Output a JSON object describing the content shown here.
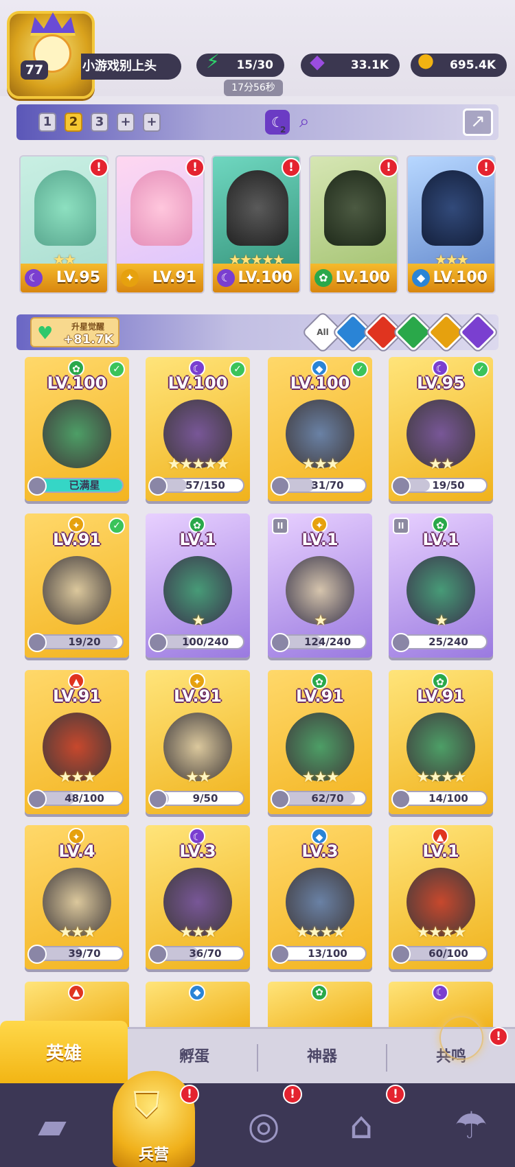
{
  "header": {
    "player_level": "77",
    "player_name": "小游戏别上头",
    "energy": "15/30",
    "energy_timer": "17分56秒",
    "gems": "33.1K",
    "gold": "695.4K"
  },
  "team_bar": {
    "tabs": [
      "1",
      "2",
      "3",
      "+",
      "+"
    ],
    "active_tab": "2",
    "moon_badge_count": "2"
  },
  "team": [
    {
      "level": "LV.95",
      "stars": "★★",
      "element": "moon",
      "alert": "!"
    },
    {
      "level": "LV.91",
      "stars": "",
      "element": "light",
      "alert": "!"
    },
    {
      "level": "LV.100",
      "stars": "★★★★★",
      "element": "moon",
      "alert": "!"
    },
    {
      "level": "LV.100",
      "stars": "",
      "element": "nature",
      "alert": "!"
    },
    {
      "level": "LV.100",
      "stars": "★★★",
      "element": "water",
      "alert": "!"
    }
  ],
  "awaken": {
    "title": "升星觉醒",
    "value": "+81.7K"
  },
  "filters": {
    "all_label": "All",
    "elements": [
      "water",
      "fire",
      "nature",
      "light",
      "moon"
    ]
  },
  "heroes": [
    {
      "level": "LV.100",
      "element": "nature",
      "checked": true,
      "stars": "",
      "progress_text": "已满星",
      "progress": 1.0
    },
    {
      "level": "LV.100",
      "element": "moon",
      "checked": true,
      "stars": "★★★★★",
      "progress_text": "57/150",
      "progress": 0.38
    },
    {
      "level": "LV.100",
      "element": "water",
      "checked": true,
      "stars": "★★★",
      "progress_text": "31/70",
      "progress": 0.44
    },
    {
      "level": "LV.95",
      "element": "moon",
      "checked": true,
      "stars": "★★",
      "progress_text": "19/50",
      "progress": 0.38
    },
    {
      "level": "LV.91",
      "element": "light",
      "checked": true,
      "stars": "",
      "progress_text": "19/20",
      "progress": 0.95
    },
    {
      "level": "LV.1",
      "element": "nature",
      "checked": false,
      "stars": "★",
      "progress_text": "100/240",
      "progress": 0.42
    },
    {
      "level": "LV.1",
      "element": "light",
      "checked": false,
      "rank": "II",
      "stars": "★",
      "progress_text": "124/240",
      "progress": 0.52
    },
    {
      "level": "LV.1",
      "element": "nature",
      "checked": false,
      "rank": "II",
      "stars": "★",
      "progress_text": "25/240",
      "progress": 0.1
    },
    {
      "level": "LV.91",
      "element": "fire",
      "checked": false,
      "stars": "★★★",
      "progress_text": "48/100",
      "progress": 0.48
    },
    {
      "level": "LV.91",
      "element": "light",
      "checked": false,
      "stars": "★★",
      "progress_text": "9/50",
      "progress": 0.18
    },
    {
      "level": "LV.91",
      "element": "nature",
      "checked": false,
      "stars": "★★★",
      "progress_text": "62/70",
      "progress": 0.89
    },
    {
      "level": "LV.91",
      "element": "nature",
      "checked": false,
      "stars": "★★★★",
      "progress_text": "14/100",
      "progress": 0.14
    },
    {
      "level": "LV.4",
      "element": "light",
      "checked": false,
      "stars": "★★★",
      "progress_text": "39/70",
      "progress": 0.56
    },
    {
      "level": "LV.3",
      "element": "moon",
      "checked": false,
      "stars": "★★★",
      "progress_text": "36/70",
      "progress": 0.51
    },
    {
      "level": "LV.3",
      "element": "water",
      "checked": false,
      "stars": "★★★★",
      "progress_text": "13/100",
      "progress": 0.13
    },
    {
      "level": "LV.1",
      "element": "fire",
      "checked": false,
      "stars": "★★★★",
      "progress_text": "60/100",
      "progress": 0.6
    }
  ],
  "peek_row": [
    "fire",
    "water",
    "nature",
    "moon"
  ],
  "sub_tabs": [
    "英雄",
    "孵蛋",
    "神器",
    "共鸣"
  ],
  "active_sub_tab": "英雄",
  "nav": {
    "items": [
      "cards-icon",
      "barracks-icon",
      "map-icon",
      "temple-icon",
      "mushroom-icon"
    ],
    "active_label": "兵营"
  },
  "colors": {
    "moon": "#7a3fd0",
    "light": "#e6a10e",
    "nature": "#2aa84a",
    "water": "#2a84d6",
    "fire": "#e0341f",
    "accent": "#f7c731"
  }
}
